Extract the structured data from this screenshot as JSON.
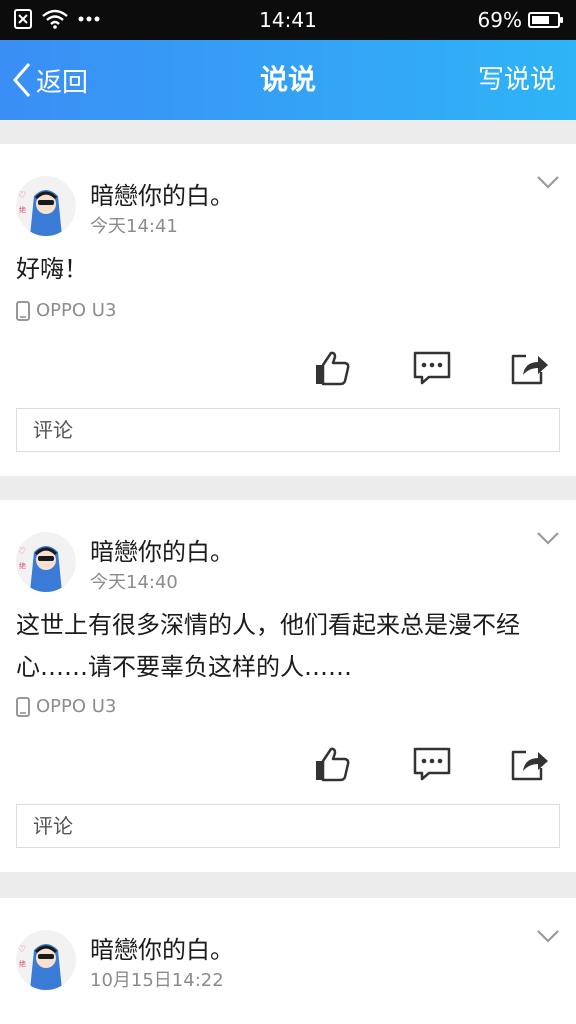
{
  "status_bar": {
    "time": "14:41",
    "battery_text": "69%",
    "battery_level": 0.69
  },
  "nav": {
    "back_label": "返回",
    "title": "说说",
    "write_label": "写说说"
  },
  "posts": [
    {
      "author": "暗戀你的白。",
      "time": "今天14:41",
      "text": "好嗨！",
      "device": "OPPO U3",
      "comment_placeholder": "评论"
    },
    {
      "author": "暗戀你的白。",
      "time": "今天14:40",
      "text": "这世上有很多深情的人，他们看起来总是漫不经心……请不要辜负这样的人……",
      "device": "OPPO U3",
      "comment_placeholder": "评论"
    },
    {
      "author": "暗戀你的白。",
      "time": "10月15日14:22"
    }
  ],
  "icons": [
    "sim-off-icon",
    "wifi-icon",
    "more-dots-icon",
    "back-chevron-icon",
    "chevron-down-icon",
    "phone-icon",
    "like-icon",
    "comment-icon",
    "share-icon"
  ],
  "colors": {
    "nav_gradient_start": "#3a8ef5",
    "nav_gradient_end": "#2fb4f7",
    "background": "#ececec"
  }
}
